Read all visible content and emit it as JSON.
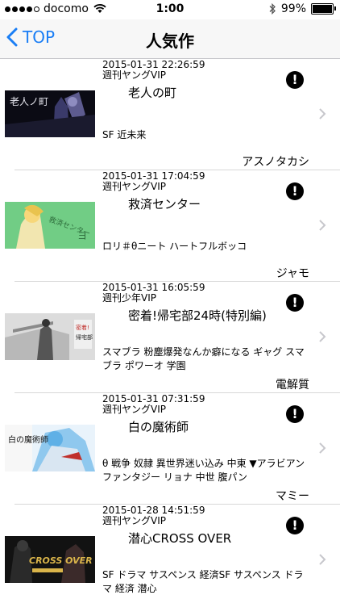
{
  "status_bar": {
    "carrier": "docomo",
    "time": "1:00",
    "battery": "99%"
  },
  "nav": {
    "back_label": "TOP",
    "title": "人気作"
  },
  "items": [
    {
      "datetime": "2015-01-31 22:26:59",
      "magazine": "週刊ヤングVIP",
      "title": "老人の町",
      "tags": "SF 近未来",
      "author": "アスノタカシ",
      "thumb_text": "老人ノ町"
    },
    {
      "datetime": "2015-01-31 17:04:59",
      "magazine": "週刊ヤングVIP",
      "title": "救済センター",
      "tags": "ロリ＃θニート ハートフルボッコ",
      "author": "ジャモ",
      "thumb_text": "救済センター"
    },
    {
      "datetime": "2015-01-31 16:05:59",
      "magazine": "週刊少年VIP",
      "title": "密着!帰宅部24時(特別編)",
      "tags": "スマブラ 粉塵爆発なんか癖になる ギャグ スマブラ ポワーオ 学園",
      "author": "電解質",
      "thumb_text": "帰宅部"
    },
    {
      "datetime": "2015-01-31 07:31:59",
      "magazine": "週刊ヤングVIP",
      "title": "白の魔術師",
      "tags": "θ 戦争 奴隷 異世界迷い込み 中東 ▼アラビアン ファンタジー リョナ 中世 腹パン",
      "author": "マミー",
      "thumb_text": "白の魔術師"
    },
    {
      "datetime": "2015-01-28 14:51:59",
      "magazine": "週刊ヤングVIP",
      "title": "潜心CROSS OVER",
      "tags": "SF ドラマ サスペンス 経済SF サスペンス ドラマ 経済 潜心",
      "author": "",
      "thumb_text": "CROSS OVER"
    }
  ]
}
